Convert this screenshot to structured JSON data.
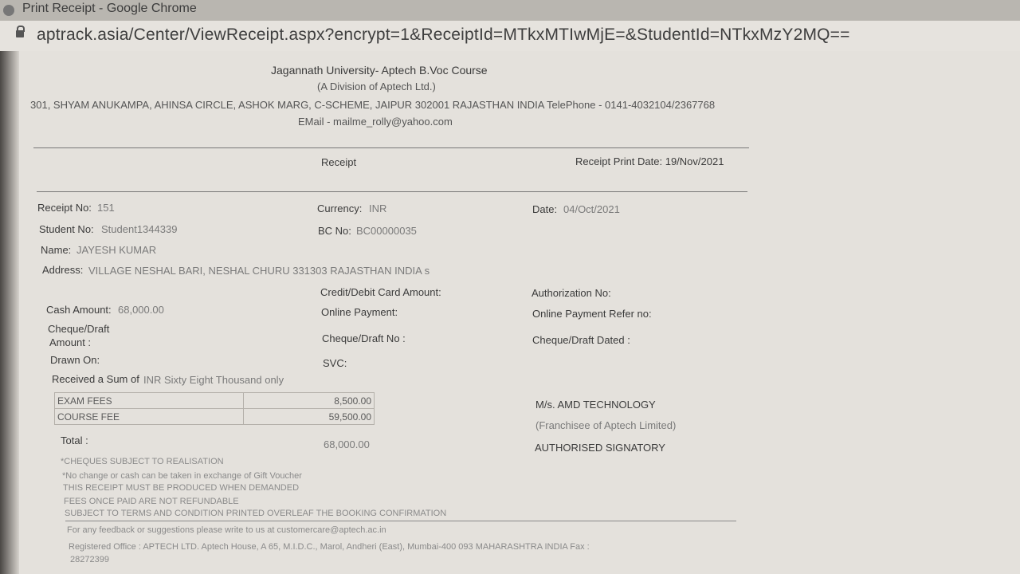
{
  "window": {
    "title": "Print Receipt - Google Chrome"
  },
  "browser": {
    "url": "aptrack.asia/Center/ViewReceipt.aspx?encrypt=1&ReceiptId=MTkxMTIwMjE=&StudentId=NTkxMzY2MQ=="
  },
  "header": {
    "org": "Jagannath University- Aptech B.Voc Course",
    "division": "(A Division of Aptech Ltd.)",
    "address": "301, SHYAM ANUKAMPA, AHINSA CIRCLE, ASHOK MARG, C-SCHEME, JAIPUR 302001 RAJASTHAN INDIA TelePhone - 0141-4032104/2367768",
    "email": "EMail - mailme_rolly@yahoo.com"
  },
  "receipt": {
    "heading": "Receipt",
    "print_date": "Receipt Print Date: 19/Nov/2021",
    "receipt_no_label": "Receipt No:",
    "receipt_no": "151",
    "currency_label": "Currency:",
    "currency": "INR",
    "date_label": "Date:",
    "date": "04/Oct/2021",
    "student_no_label": "Student No:",
    "student_no": "Student1344339",
    "bc_no_label": "BC No:",
    "bc_no": "BC00000035",
    "name_label": "Name:",
    "name": "JAYESH KUMAR",
    "address_label": "Address:",
    "address": "VILLAGE NESHAL BARI, NESHAL CHURU 331303 RAJASTHAN INDIA s",
    "credit_card_label": "Credit/Debit Card Amount:",
    "authorization_label": "Authorization No:",
    "cash_label": "Cash Amount:",
    "cash": "68,000.00",
    "online_payment_label": "Online Payment:",
    "online_ref_label": "Online Payment Refer no:",
    "cheque_amount_label_1": "Cheque/Draft",
    "cheque_amount_label_2": "Amount :",
    "cheque_no_label": "Cheque/Draft No :",
    "cheque_dated_label": "Cheque/Draft Dated :",
    "drawn_on_label": "Drawn On:",
    "svc_label": "SVC:",
    "received_label": "Received a Sum of",
    "received_value": "INR Sixty Eight Thousand only"
  },
  "fees": [
    {
      "name": "EXAM FEES",
      "amount": "8,500.00"
    },
    {
      "name": "COURSE FEE",
      "amount": "59,500.00"
    }
  ],
  "total_label": "Total :",
  "total": "68,000.00",
  "signatory": {
    "company": "M/s. AMD TECHNOLOGY",
    "franchise": "(Franchisee of Aptech Limited)",
    "authorised": "AUTHORISED SIGNATORY"
  },
  "notes": [
    "*CHEQUES SUBJECT TO REALISATION",
    "*No change or cash can be taken in exchange of Gift Voucher",
    "THIS RECEIPT MUST BE PRODUCED WHEN DEMANDED",
    "FEES ONCE PAID ARE NOT REFUNDABLE",
    "SUBJECT TO TERMS AND CONDITION PRINTED OVERLEAF THE BOOKING CONFIRMATION"
  ],
  "footer": {
    "feedback": "For any feedback or suggestions please write to us at customercare@aptech.ac.in",
    "registered_office": "Registered Office : APTECH LTD. Aptech House, A 65, M.I.D.C., Marol, Andheri (East), Mumbai-400 093 MAHARASHTRA INDIA Fax :",
    "fax": "28272399"
  }
}
